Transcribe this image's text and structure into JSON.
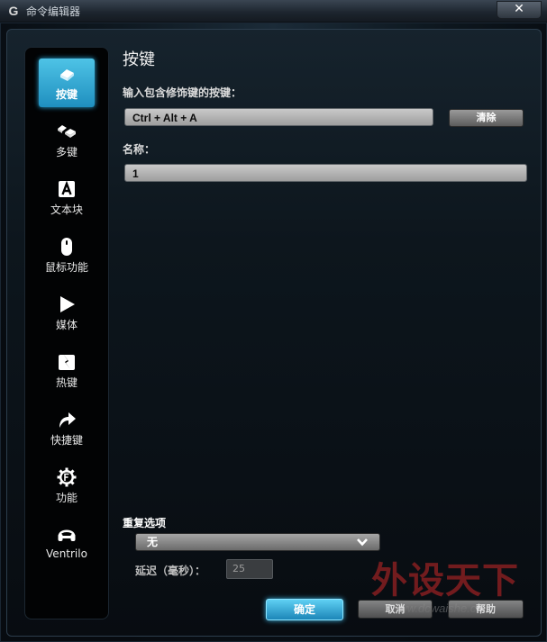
{
  "window": {
    "logo": "G",
    "title": "命令编辑器",
    "close": "✕"
  },
  "sidebar": {
    "items": [
      {
        "label": "按键",
        "icon": "keycap-icon",
        "active": true
      },
      {
        "label": "多键",
        "icon": "multi-key-icon",
        "active": false
      },
      {
        "label": "文本块",
        "icon": "text-block-icon",
        "active": false
      },
      {
        "label": "鼠标功能",
        "icon": "mouse-icon",
        "active": false
      },
      {
        "label": "媒体",
        "icon": "play-icon",
        "active": false
      },
      {
        "label": "热键",
        "icon": "hotkey-icon",
        "active": false
      },
      {
        "label": "快捷键",
        "icon": "shortcut-arrow-icon",
        "active": false
      },
      {
        "label": "功能",
        "icon": "function-gear-icon",
        "active": false
      },
      {
        "label": "Ventrilo",
        "icon": "headset-icon",
        "active": false
      }
    ]
  },
  "main": {
    "title": "按键",
    "keystroke_label": "输入包含修饰键的按键：",
    "keystroke_value": "Ctrl + Alt + A",
    "clear_label": "清除",
    "name_label": "名称：",
    "name_value": "1",
    "repeat_label": "重复选项",
    "repeat_value": "无",
    "delay_label": "延迟（毫秒）：",
    "delay_value": "25"
  },
  "footer": {
    "ok": "确定",
    "cancel": "取消",
    "help": "帮助"
  },
  "watermark": {
    "text": "外设天下",
    "url": "www.dcwaishe.cn"
  },
  "colors": {
    "accent": "#2da9dc",
    "background": "#080c11"
  }
}
